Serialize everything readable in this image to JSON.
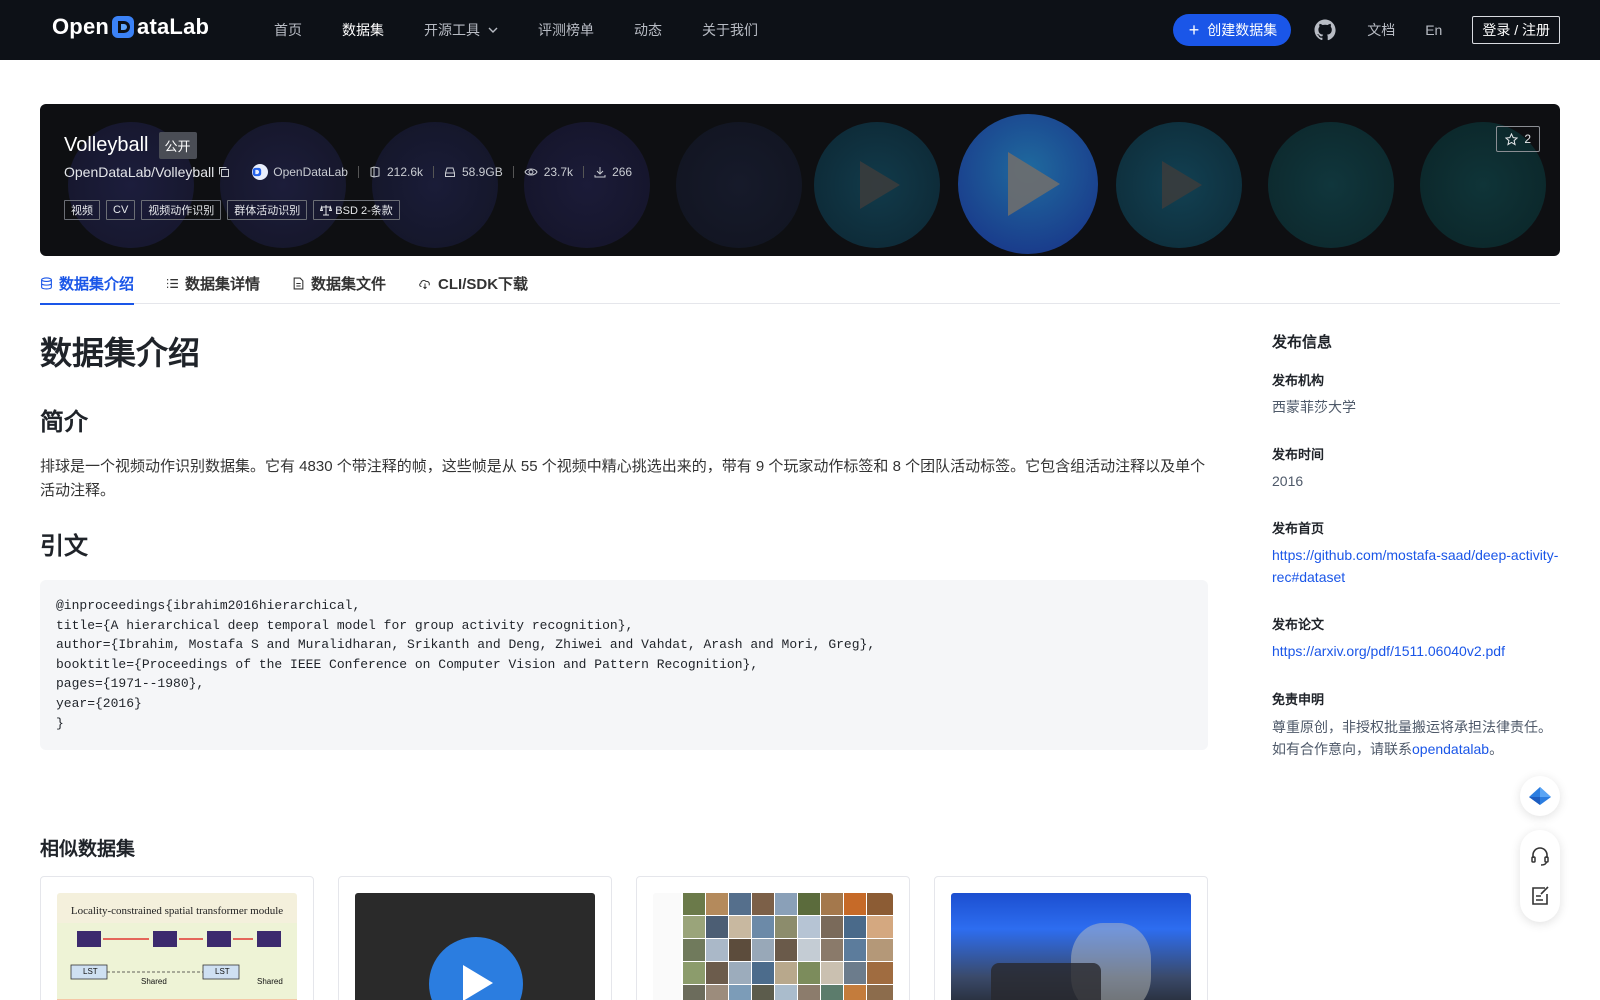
{
  "nav": {
    "logo_text_left": "Open",
    "logo_text_right": "ataLab",
    "links": [
      "首页",
      "数据集",
      "开源工具",
      "评测榜单",
      "动态",
      "关于我们"
    ],
    "active": "数据集",
    "create_label": "创建数据集",
    "docs_label": "文档",
    "lang_label": "En",
    "login_label": "登录 / 注册"
  },
  "dataset": {
    "name": "Volleyball",
    "visibility": "公开",
    "path": "OpenDataLab/Volleyball",
    "org": "OpenDataLab",
    "files": "212.6k",
    "size": "58.9GB",
    "views": "23.7k",
    "downloads": "266",
    "tags": [
      "视频",
      "CV",
      "视频动作识别",
      "群体活动识别"
    ],
    "license": "BSD 2-条款",
    "stars": "2"
  },
  "tabs": [
    "数据集介绍",
    "数据集详情",
    "数据集文件",
    "CLI/SDK下载"
  ],
  "content": {
    "heading": "数据集介绍",
    "intro_heading": "简介",
    "intro_text": "排球是一个视频动作识别数据集。它有 4830 个带注释的帧，这些帧是从 55 个视频中精心挑选出来的，带有 9 个玩家动作标签和 8 个团队活动标签。它包含组活动注释以及单个活动注释。",
    "citation_heading": "引文",
    "citation": "@inproceedings{ibrahim2016hierarchical,\ntitle={A hierarchical deep temporal model for group activity recognition},\nauthor={Ibrahim, Mostafa S and Muralidharan, Srikanth and Deng, Zhiwei and Vahdat, Arash and Mori, Greg},\nbooktitle={Proceedings of the IEEE Conference on Computer Vision and Pattern Recognition},\npages={1971--1980},\nyear={2016}\n}"
  },
  "sidebar": {
    "title": "发布信息",
    "publisher_label": "发布机构",
    "publisher": "西蒙菲莎大学",
    "time_label": "发布时间",
    "time": "2016",
    "homepage_label": "发布首页",
    "homepage": "https://github.com/mostafa-saad/deep-activity-rec#dataset",
    "paper_label": "发布论文",
    "paper": "https://arxiv.org/pdf/1511.06040v2.pdf",
    "disclaimer_label": "免责申明",
    "disclaimer_line1": "尊重原创，非授权批量搬运将承担法律责任。",
    "disclaimer_line2_prefix": "如有合作意向，请联系",
    "disclaimer_link": "opendatalab",
    "disclaimer_suffix": "。"
  },
  "similar": {
    "title": "相似数据集",
    "card1_caption": "Locality-constrained spatial transformer module",
    "card1_box_a": "LST",
    "card1_box_b": "LST",
    "card1_shared_a": "Shared",
    "card1_shared_b": "Shared"
  },
  "colors": {
    "accent": "#1a56e8",
    "nav_bg": "#0d1117",
    "banner_bg": "#0e0f12"
  }
}
